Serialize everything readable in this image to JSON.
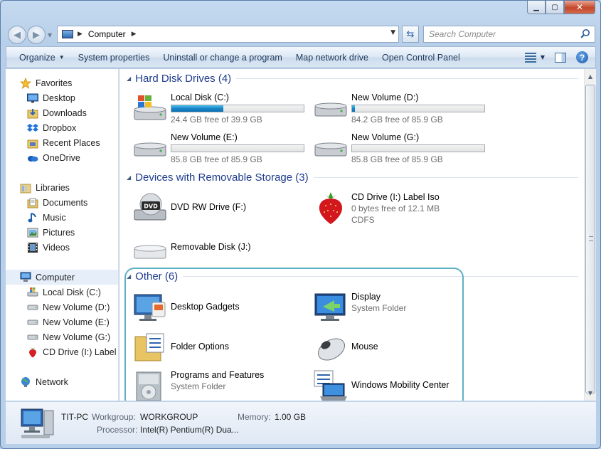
{
  "window": {
    "caption": {
      "minimize": "▁",
      "maximize": "▢",
      "close": "✕"
    }
  },
  "address": {
    "crumbs": [
      "Computer"
    ],
    "search_placeholder": "Search Computer"
  },
  "toolbar": {
    "organize": "Organize",
    "system_properties": "System properties",
    "uninstall": "Uninstall or change a program",
    "map_drive": "Map network drive",
    "control_panel": "Open Control Panel"
  },
  "nav": {
    "favorites": "Favorites",
    "desktop": "Desktop",
    "downloads": "Downloads",
    "dropbox": "Dropbox",
    "recent": "Recent Places",
    "onedrive": "OneDrive",
    "libraries": "Libraries",
    "documents": "Documents",
    "music": "Music",
    "pictures": "Pictures",
    "videos": "Videos",
    "computer": "Computer",
    "drive_c": "Local Disk (C:)",
    "drive_d": "New Volume (D:)",
    "drive_e": "New Volume (E:)",
    "drive_g": "New Volume (G:)",
    "drive_i": "CD Drive (I:) Label Is",
    "network": "Network"
  },
  "groups": {
    "hdd": "Hard Disk Drives (4)",
    "removable": "Devices with Removable Storage (3)",
    "other": "Other (6)"
  },
  "drives": [
    {
      "name": "Local Disk (C:)",
      "free": "24.4 GB free of 39.9 GB",
      "used_fraction": 0.39
    },
    {
      "name": "New Volume (D:)",
      "free": "84.2 GB free of 85.9 GB",
      "used_fraction": 0.02
    },
    {
      "name": "New Volume (E:)",
      "free": "85.8 GB free of 85.9 GB",
      "used_fraction": 0.0
    },
    {
      "name": "New Volume (G:)",
      "free": "85.8 GB free of 85.9 GB",
      "used_fraction": 0.0
    }
  ],
  "removable": {
    "dvd": {
      "name": "DVD RW Drive (F:)",
      "badge": "DVD"
    },
    "cd": {
      "name": "CD Drive (I:) Label Iso",
      "free": "0 bytes free of 12.1 MB",
      "fs": "CDFS"
    },
    "disk": {
      "name": "Removable Disk (J:)"
    }
  },
  "other": {
    "gadgets": {
      "name": "Desktop Gadgets"
    },
    "display": {
      "name": "Display",
      "sub": "System Folder"
    },
    "folder_options": {
      "name": "Folder Options"
    },
    "mouse": {
      "name": "Mouse"
    },
    "programs": {
      "name": "Programs and Features",
      "sub": "System Folder"
    },
    "mobility": {
      "name": "Windows Mobility Center"
    }
  },
  "details": {
    "pc_name": "TIT-PC",
    "workgroup_label": "Workgroup:",
    "workgroup": "WORKGROUP",
    "memory_label": "Memory:",
    "memory": "1.00 GB",
    "processor_label": "Processor:",
    "processor": "Intel(R) Pentium(R) Dua..."
  }
}
